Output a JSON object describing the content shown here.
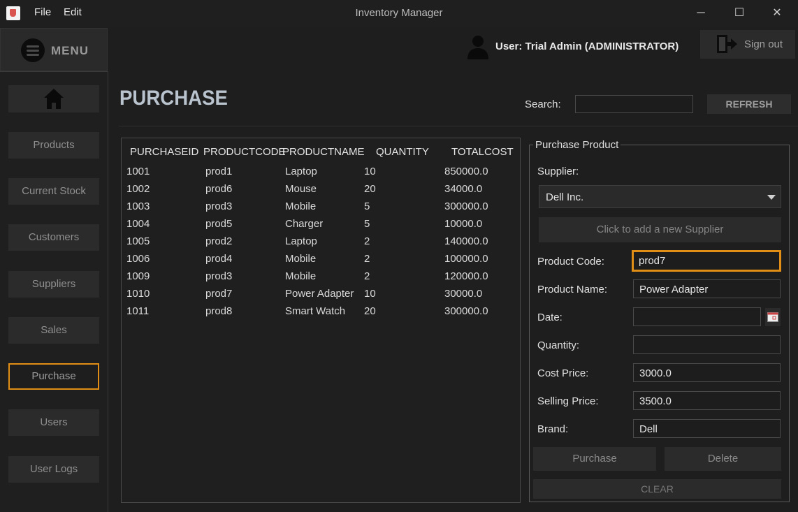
{
  "window": {
    "title": "Inventory Manager",
    "menus": [
      "File",
      "Edit"
    ],
    "controls": [
      "─",
      "☐",
      "✕"
    ]
  },
  "header": {
    "menu_label": "MENU",
    "user_label": "User: Trial Admin (ADMINISTRATOR)",
    "signout_label": "Sign out"
  },
  "sidebar": {
    "items": [
      {
        "label": "Products"
      },
      {
        "label": "Current Stock"
      },
      {
        "label": "Customers"
      },
      {
        "label": "Suppliers"
      },
      {
        "label": "Sales"
      },
      {
        "label": "Purchase",
        "active": true
      },
      {
        "label": "Users"
      },
      {
        "label": "User Logs"
      }
    ]
  },
  "main": {
    "title": "PURCHASE",
    "search_label": "Search:",
    "search_value": "",
    "refresh_label": "REFRESH",
    "table": {
      "columns": [
        "PURCHASEID",
        "PRODUCTCODE",
        "PRODUCTNAME",
        "QUANTITY",
        "TOTALCOST"
      ],
      "rows": [
        [
          "1001",
          "prod1",
          "Laptop",
          "10",
          "850000.0"
        ],
        [
          "1002",
          "prod6",
          "Mouse",
          "20",
          "34000.0"
        ],
        [
          "1003",
          "prod3",
          "Mobile",
          "5",
          "300000.0"
        ],
        [
          "1004",
          "prod5",
          "Charger",
          "5",
          "10000.0"
        ],
        [
          "1005",
          "prod2",
          "Laptop",
          "2",
          "140000.0"
        ],
        [
          "1006",
          "prod4",
          "Mobile",
          "2",
          "100000.0"
        ],
        [
          "1009",
          "prod3",
          "Mobile",
          "2",
          "120000.0"
        ],
        [
          "1010",
          "prod7",
          "Power Adapter",
          "10",
          "30000.0"
        ],
        [
          "1011",
          "prod8",
          "Smart Watch",
          "20",
          "300000.0"
        ]
      ]
    }
  },
  "panel": {
    "legend": "Purchase Product",
    "supplier_label": "Supplier:",
    "supplier_value": "Dell Inc.",
    "add_supplier_label": "Click to add a new Supplier",
    "product_code_label": "Product Code:",
    "product_code_value": "prod7",
    "product_name_label": "Product Name:",
    "product_name_value": "Power Adapter",
    "date_label": "Date:",
    "date_value": "",
    "quantity_label": "Quantity:",
    "quantity_value": "",
    "cost_price_label": "Cost Price:",
    "cost_price_value": "3000.0",
    "selling_price_label": "Selling Price:",
    "selling_price_value": "3500.0",
    "brand_label": "Brand:",
    "brand_value": "Dell",
    "purchase_label": "Purchase",
    "delete_label": "Delete",
    "clear_label": "CLEAR"
  },
  "colors": {
    "accent": "#e08e15",
    "background": "#1e1e1e",
    "button": "#2b2b2b"
  }
}
